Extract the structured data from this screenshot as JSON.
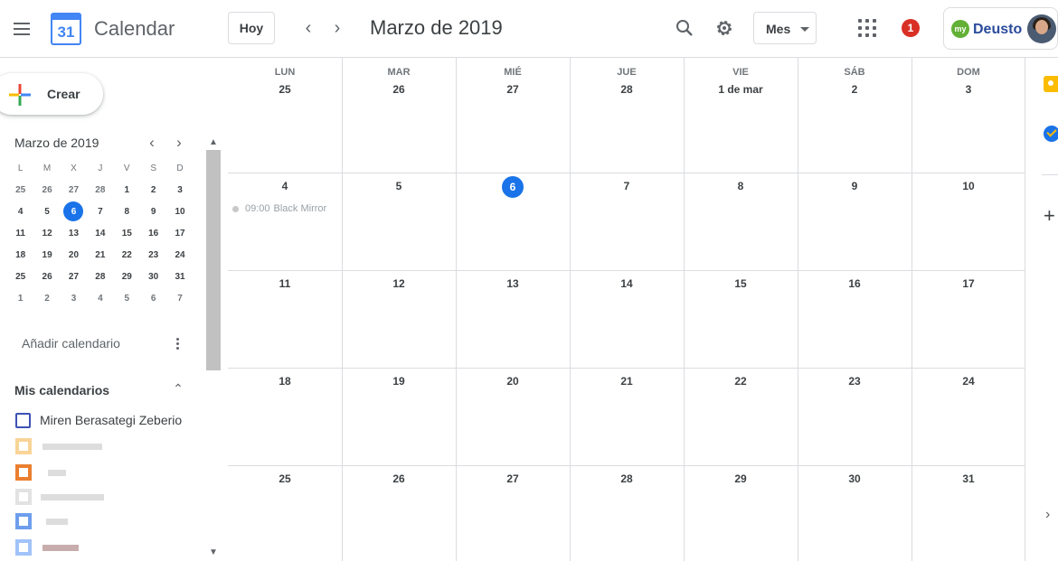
{
  "header": {
    "app_name": "Calendar",
    "logo_day": "31",
    "today_label": "Hoy",
    "prev_label": "‹",
    "next_label": "›",
    "month_title": "Marzo de 2019",
    "view_label": "Mes",
    "notification_count": "1",
    "brand_badge": "my",
    "brand_name": "Deusto"
  },
  "sidebar": {
    "create_label": "Crear",
    "mini_calendar": {
      "title": "Marzo de 2019",
      "prev_label": "‹",
      "next_label": "›",
      "weekday_heads": [
        "L",
        "M",
        "X",
        "J",
        "V",
        "S",
        "D"
      ],
      "weeks": [
        [
          "25",
          "26",
          "27",
          "28",
          "1",
          "2",
          "3"
        ],
        [
          "4",
          "5",
          "6",
          "7",
          "8",
          "9",
          "10"
        ],
        [
          "11",
          "12",
          "13",
          "14",
          "15",
          "16",
          "17"
        ],
        [
          "18",
          "19",
          "20",
          "21",
          "22",
          "23",
          "24"
        ],
        [
          "25",
          "26",
          "27",
          "28",
          "29",
          "30",
          "31"
        ],
        [
          "1",
          "2",
          "3",
          "4",
          "5",
          "6",
          "7"
        ]
      ],
      "today": "6"
    },
    "add_calendar_label": "Añadir calendario",
    "my_calendars_label": "Mis calendarios",
    "calendar_name": "Miren Berasategi Zeberio"
  },
  "grid": {
    "weekdays": [
      "LUN",
      "MAR",
      "MIÉ",
      "JUE",
      "VIE",
      "SÁB",
      "DOM"
    ],
    "weeks": [
      [
        "25",
        "26",
        "27",
        "28",
        "1 de mar",
        "2",
        "3"
      ],
      [
        "4",
        "5",
        "6",
        "7",
        "8",
        "9",
        "10"
      ],
      [
        "11",
        "12",
        "13",
        "14",
        "15",
        "16",
        "17"
      ],
      [
        "18",
        "19",
        "20",
        "21",
        "22",
        "23",
        "24"
      ],
      [
        "25",
        "26",
        "27",
        "28",
        "29",
        "30",
        "31"
      ]
    ],
    "today": "6",
    "event": {
      "time": "09:00",
      "title": "Black Mirror"
    }
  },
  "colors": {
    "accent": "#1a73e8",
    "badge": "#d93025",
    "calendar_checkbox": "#3f51b5",
    "keep": "#fbbc04"
  },
  "icons": [
    "menu-icon",
    "calendar-logo-icon",
    "search-icon",
    "gear-icon",
    "apps-icon",
    "plus-icon",
    "kebab-icon",
    "chevron-up-icon",
    "keep-icon",
    "tasks-icon"
  ]
}
